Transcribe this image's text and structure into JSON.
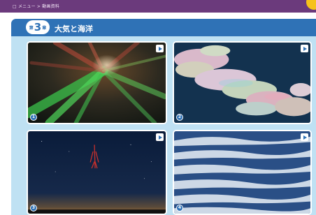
{
  "header": {
    "breadcrumb": "□ メニュー > 動画資料"
  },
  "chapter": {
    "prefix": "第",
    "number": "3",
    "suffix": "章",
    "title": "大気と海洋"
  },
  "videos": [
    {
      "number": "1",
      "play_icon": "play-icon"
    },
    {
      "number": "2",
      "play_icon": "play-icon"
    },
    {
      "number": "3",
      "play_icon": "play-icon"
    },
    {
      "number": "4",
      "play_icon": "play-icon"
    }
  ],
  "colors": {
    "accent": "#2f72b6",
    "header_strip": "#6b3a7c",
    "panel": "#bfe1f3",
    "corner_marker": "#f6c21a"
  }
}
